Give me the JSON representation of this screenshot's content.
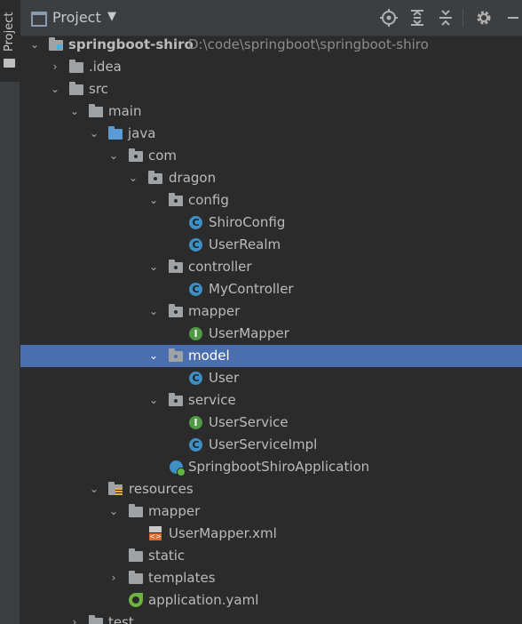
{
  "sidebar": {
    "tab_label": "Project"
  },
  "toolbar": {
    "title": "Project",
    "dropdown_icon": "caret-down-icon",
    "icons": [
      "locate-icon",
      "expand-all-icon",
      "collapse-all-icon",
      "settings-icon",
      "hide-icon"
    ]
  },
  "tree": {
    "project": {
      "name": "springboot-shiro",
      "path": "D:\\code\\springboot\\springboot-shiro"
    },
    "idea": ".idea",
    "src": "src",
    "main": "main",
    "java": "java",
    "com": "com",
    "dragon": "dragon",
    "config": "config",
    "shiro_config": "ShiroConfig",
    "user_realm": "UserRealm",
    "controller": "controller",
    "my_controller": "MyController",
    "mapper": "mapper",
    "user_mapper": "UserMapper",
    "model": "model",
    "user": "User",
    "service": "service",
    "user_service": "UserService",
    "user_service_impl": "UserServiceImpl",
    "app": "SpringbootShiroApplication",
    "resources": "resources",
    "res_mapper": "mapper",
    "user_mapper_xml": "UserMapper.xml",
    "static": "static",
    "templates": "templates",
    "application_yaml": "application.yaml",
    "test": "test"
  },
  "icon_badges": {
    "class": "C",
    "interface": "I",
    "xml": "<>"
  },
  "colors": {
    "selection": "#4b6eaf",
    "background": "#2b2b2b",
    "class_icon": "#3d8fc4",
    "interface_icon": "#4f9a44"
  }
}
